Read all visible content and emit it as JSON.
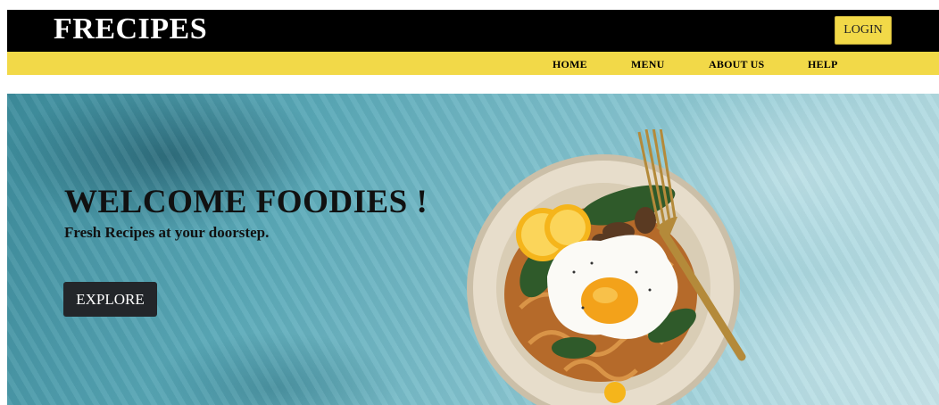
{
  "header": {
    "brand": "FRECIPES",
    "login_label": "LOGIN"
  },
  "nav": {
    "items": [
      "HOME",
      "MENU",
      "ABOUT US",
      "HELP"
    ]
  },
  "hero": {
    "title": "WELCOME FOODIES !",
    "subtitle": "Fresh Recipes at your doorstep.",
    "explore_label": "EXPLORE",
    "image": "plate-of-food-with-fried-egg"
  },
  "colors": {
    "topbar": "#000000",
    "accent": "#f2d948",
    "button_dark": "#23262a",
    "hero_bg": "#5aa9b8"
  }
}
